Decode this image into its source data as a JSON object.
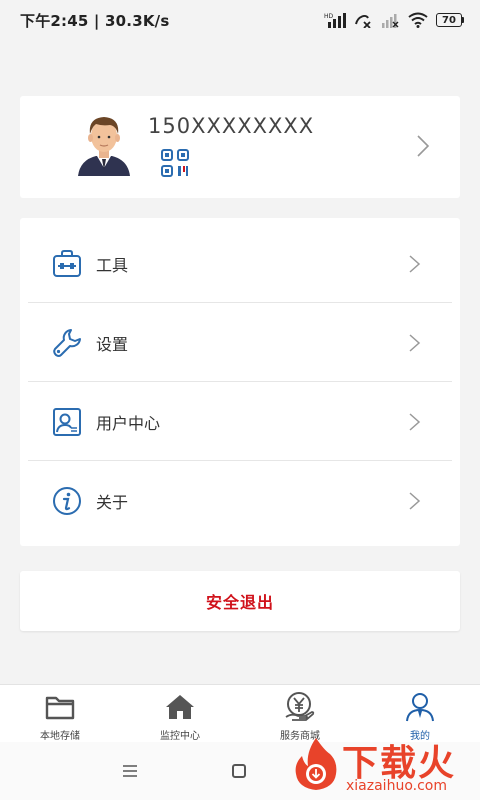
{
  "status_bar": {
    "time": "下午2:45 | 30.3K/s",
    "battery": "70"
  },
  "profile": {
    "phone": "150XXXXXXXX"
  },
  "menu": [
    {
      "label": "工具",
      "icon": "toolbox-icon"
    },
    {
      "label": "设置",
      "icon": "wrench-icon"
    },
    {
      "label": "用户中心",
      "icon": "user-card-icon"
    },
    {
      "label": "关于",
      "icon": "info-icon"
    }
  ],
  "logout": {
    "label": "安全退出"
  },
  "tabs": [
    {
      "label": "本地存储",
      "icon": "folder-icon"
    },
    {
      "label": "监控中心",
      "icon": "home-icon"
    },
    {
      "label": "服务商城",
      "icon": "yen-shop-icon"
    },
    {
      "label": "我的",
      "icon": "person-icon"
    }
  ],
  "watermark": {
    "title": "下载火",
    "url": "xiazaihuo.com"
  },
  "colors": {
    "accent": "#1f5fa8",
    "logout": "#d0121b",
    "background": "#f3f3f3"
  }
}
